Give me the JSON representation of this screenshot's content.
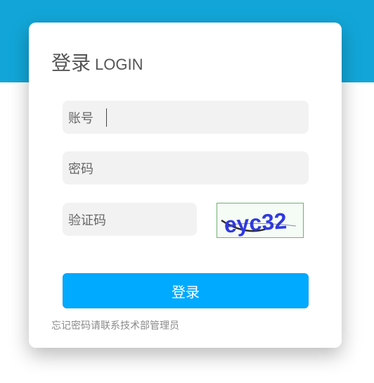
{
  "header": {
    "title_cn": "登录",
    "title_en": "LOGIN"
  },
  "form": {
    "account_placeholder": "账号",
    "password_placeholder": "密码",
    "captcha_placeholder": "验证码",
    "captcha_text": "eyc32",
    "submit_label": "登录"
  },
  "footer": {
    "hint": "忘记密码请联系技术部管理员"
  },
  "colors": {
    "band": "#12a6d8",
    "button": "#00aaff",
    "field_bg": "#f2f2f2"
  }
}
